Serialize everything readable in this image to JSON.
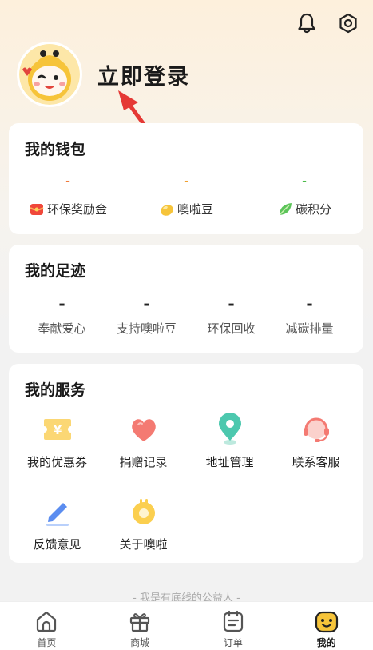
{
  "header": {
    "icons": [
      "bell-icon",
      "settings-icon"
    ]
  },
  "profile": {
    "login_label": "立即登录"
  },
  "wallet": {
    "title": "我的钱包",
    "items": [
      {
        "value": "-",
        "value_color": "#f07a3c",
        "label": "环保奖励金",
        "icon": "red-envelope-icon"
      },
      {
        "value": "-",
        "value_color": "#f0a030",
        "label": "噢啦豆",
        "icon": "bean-icon"
      },
      {
        "value": "-",
        "value_color": "#4cbb4a",
        "label": "碳积分",
        "icon": "leaf-icon"
      }
    ]
  },
  "footprint": {
    "title": "我的足迹",
    "items": [
      {
        "value": "-",
        "label": "奉献爱心"
      },
      {
        "value": "-",
        "label": "支持噢啦豆"
      },
      {
        "value": "-",
        "label": "环保回收"
      },
      {
        "value": "-",
        "label": "减碳排量"
      }
    ]
  },
  "services": {
    "title": "我的服务",
    "items": [
      {
        "label": "我的优惠券",
        "icon": "coupon-icon"
      },
      {
        "label": "捐赠记录",
        "icon": "heart-icon"
      },
      {
        "label": "地址管理",
        "icon": "location-icon"
      },
      {
        "label": "联系客服",
        "icon": "headset-icon"
      },
      {
        "label": "反馈意见",
        "icon": "pen-icon"
      },
      {
        "label": "关于噢啦",
        "icon": "about-icon"
      }
    ]
  },
  "slogan": "- 我是有底线的公益人 -",
  "tabbar": {
    "items": [
      {
        "label": "首页",
        "icon": "home-icon"
      },
      {
        "label": "商城",
        "icon": "gift-icon"
      },
      {
        "label": "订单",
        "icon": "order-icon"
      },
      {
        "label": "我的",
        "icon": "mine-icon",
        "active": true
      }
    ]
  }
}
